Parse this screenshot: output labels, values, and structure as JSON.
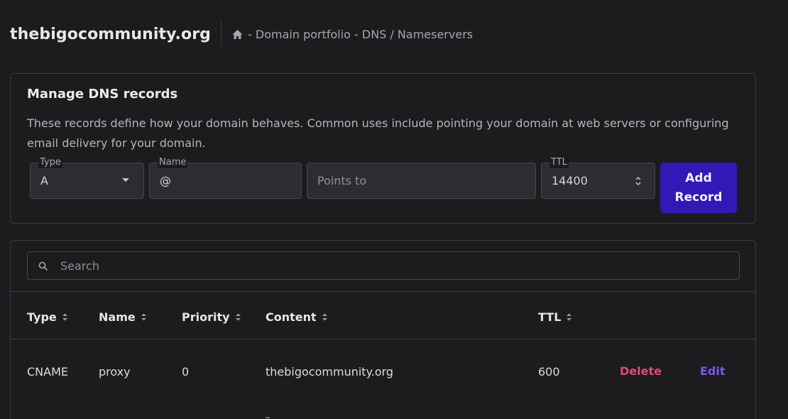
{
  "header": {
    "site_title": "thebigocommunity.org",
    "breadcrumb": "- Domain portfolio - DNS / Nameservers"
  },
  "manage": {
    "title": "Manage DNS records",
    "description": "These records define how your domain behaves. Common uses include pointing your domain at web servers or configuring email delivery for your domain.",
    "type_label": "Type",
    "type_value": "A",
    "name_label": "Name",
    "name_value": "@",
    "points_to_placeholder": "Points to",
    "ttl_label": "TTL",
    "ttl_value": "14400",
    "add_button_label": "Add Record"
  },
  "table": {
    "search_placeholder": "Search",
    "columns": [
      "Type",
      "Name",
      "Priority",
      "Content",
      "TTL"
    ],
    "rows": [
      {
        "type": "CNAME",
        "name": "proxy",
        "priority": "0",
        "content": "thebigocommunity.org",
        "ttl": "600",
        "delete_label": "Delete",
        "edit_label": "Edit"
      }
    ]
  },
  "colors": {
    "background": "#1c1c1f",
    "accent": "#3318b6",
    "delete": "#e2477a",
    "edit": "#7b55e6"
  }
}
